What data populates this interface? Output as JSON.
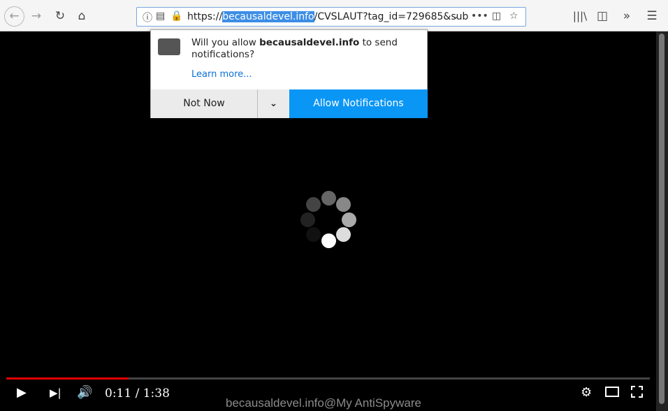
{
  "browser": {
    "url_prefix": "https://",
    "url_domain": "becausaldevel.info",
    "url_rest": "/CVSLAUT?tag_id=729685&sub"
  },
  "popup": {
    "text_pre": "Will you allow ",
    "domain": "becausaldevel.info",
    "text_post": " to send notifications?",
    "learn_more": "Learn more...",
    "not_now": "Not Now",
    "allow": "Allow Notifications"
  },
  "player": {
    "current_time": "0:11",
    "separator": " / ",
    "duration": "1:38",
    "progress": 0.19,
    "accent": "#e00000"
  },
  "watermark": "becausaldevel.info@My AntiSpyware"
}
